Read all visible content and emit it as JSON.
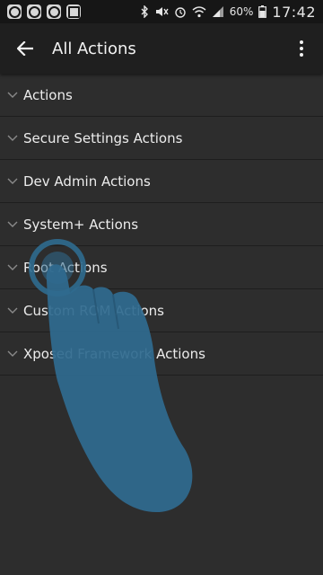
{
  "status_bar": {
    "notification_icons": [
      "app-notification-icon",
      "app-notification-icon",
      "app-notification-icon",
      "image-notification-icon"
    ],
    "system_icons": [
      "bluetooth-icon",
      "mute-icon",
      "alarm-icon",
      "wifi-icon",
      "signal-icon"
    ],
    "battery": "60%",
    "time": "17:42"
  },
  "app_bar": {
    "title": "All Actions",
    "back_icon": "arrow-back-icon",
    "menu_icon": "more-vert-icon"
  },
  "categories": [
    {
      "label": "Actions"
    },
    {
      "label": "Secure Settings Actions"
    },
    {
      "label": "Dev Admin Actions"
    },
    {
      "label": "System+ Actions"
    },
    {
      "label": "Root Actions"
    },
    {
      "label": "Custom ROM Actions"
    },
    {
      "label": "Xposed Framework Actions"
    }
  ],
  "colors": {
    "background": "#2d2d2d",
    "app_bar": "#1f1f1f",
    "status_bar": "#161616",
    "overlay_hand": "#2f6b8f"
  }
}
